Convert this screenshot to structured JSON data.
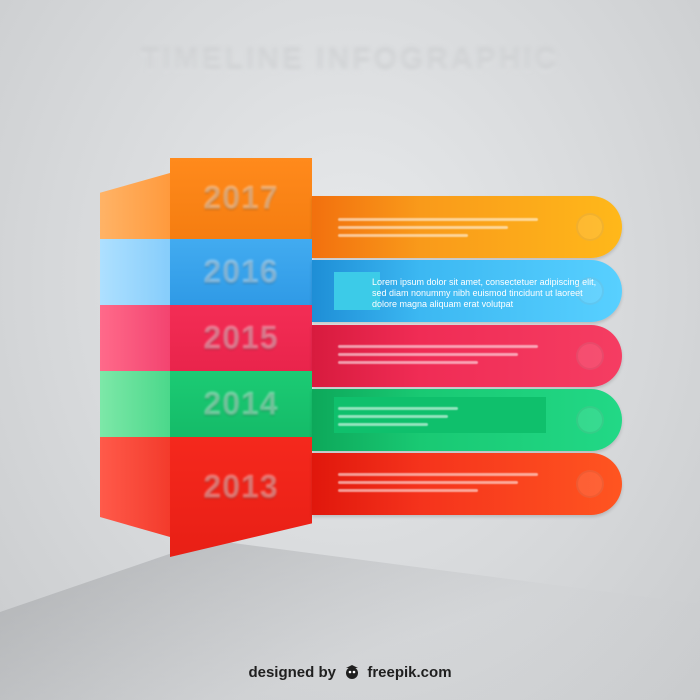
{
  "title": "TIMELINE INFOGRAPHIC",
  "rows": [
    {
      "year": "2017",
      "color": "#ff8c1a"
    },
    {
      "year": "2016",
      "color": "#3aa8f0"
    },
    {
      "year": "2015",
      "color": "#f02c55"
    },
    {
      "year": "2014",
      "color": "#19c973"
    },
    {
      "year": "2013",
      "color": "#f5261c"
    }
  ],
  "description_lines": [
    "Lorem ipsum dolor sit amet, consectetuer adipiscing elit,",
    "sed diam nonummy nibh euismod tincidunt ut laoreet",
    "dolore magna aliquam erat volutpat"
  ],
  "footer": {
    "designed_by": "designed by",
    "brand": "freepik.com"
  }
}
